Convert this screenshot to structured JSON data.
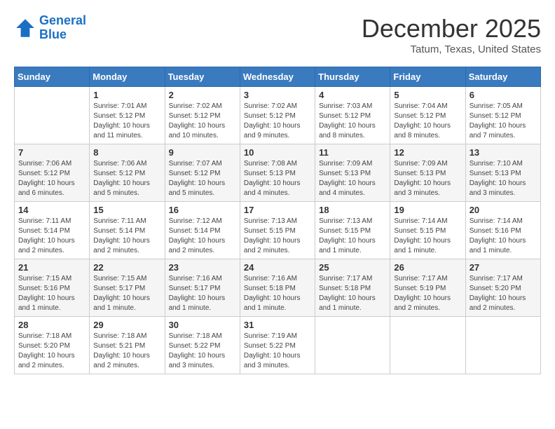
{
  "header": {
    "logo_line1": "General",
    "logo_line2": "Blue",
    "month": "December 2025",
    "location": "Tatum, Texas, United States"
  },
  "weekdays": [
    "Sunday",
    "Monday",
    "Tuesday",
    "Wednesday",
    "Thursday",
    "Friday",
    "Saturday"
  ],
  "weeks": [
    [
      {
        "day": "",
        "info": ""
      },
      {
        "day": "1",
        "info": "Sunrise: 7:01 AM\nSunset: 5:12 PM\nDaylight: 10 hours\nand 11 minutes."
      },
      {
        "day": "2",
        "info": "Sunrise: 7:02 AM\nSunset: 5:12 PM\nDaylight: 10 hours\nand 10 minutes."
      },
      {
        "day": "3",
        "info": "Sunrise: 7:02 AM\nSunset: 5:12 PM\nDaylight: 10 hours\nand 9 minutes."
      },
      {
        "day": "4",
        "info": "Sunrise: 7:03 AM\nSunset: 5:12 PM\nDaylight: 10 hours\nand 8 minutes."
      },
      {
        "day": "5",
        "info": "Sunrise: 7:04 AM\nSunset: 5:12 PM\nDaylight: 10 hours\nand 8 minutes."
      },
      {
        "day": "6",
        "info": "Sunrise: 7:05 AM\nSunset: 5:12 PM\nDaylight: 10 hours\nand 7 minutes."
      }
    ],
    [
      {
        "day": "7",
        "info": "Sunrise: 7:06 AM\nSunset: 5:12 PM\nDaylight: 10 hours\nand 6 minutes."
      },
      {
        "day": "8",
        "info": "Sunrise: 7:06 AM\nSunset: 5:12 PM\nDaylight: 10 hours\nand 5 minutes."
      },
      {
        "day": "9",
        "info": "Sunrise: 7:07 AM\nSunset: 5:12 PM\nDaylight: 10 hours\nand 5 minutes."
      },
      {
        "day": "10",
        "info": "Sunrise: 7:08 AM\nSunset: 5:13 PM\nDaylight: 10 hours\nand 4 minutes."
      },
      {
        "day": "11",
        "info": "Sunrise: 7:09 AM\nSunset: 5:13 PM\nDaylight: 10 hours\nand 4 minutes."
      },
      {
        "day": "12",
        "info": "Sunrise: 7:09 AM\nSunset: 5:13 PM\nDaylight: 10 hours\nand 3 minutes."
      },
      {
        "day": "13",
        "info": "Sunrise: 7:10 AM\nSunset: 5:13 PM\nDaylight: 10 hours\nand 3 minutes."
      }
    ],
    [
      {
        "day": "14",
        "info": "Sunrise: 7:11 AM\nSunset: 5:14 PM\nDaylight: 10 hours\nand 2 minutes."
      },
      {
        "day": "15",
        "info": "Sunrise: 7:11 AM\nSunset: 5:14 PM\nDaylight: 10 hours\nand 2 minutes."
      },
      {
        "day": "16",
        "info": "Sunrise: 7:12 AM\nSunset: 5:14 PM\nDaylight: 10 hours\nand 2 minutes."
      },
      {
        "day": "17",
        "info": "Sunrise: 7:13 AM\nSunset: 5:15 PM\nDaylight: 10 hours\nand 2 minutes."
      },
      {
        "day": "18",
        "info": "Sunrise: 7:13 AM\nSunset: 5:15 PM\nDaylight: 10 hours\nand 1 minute."
      },
      {
        "day": "19",
        "info": "Sunrise: 7:14 AM\nSunset: 5:15 PM\nDaylight: 10 hours\nand 1 minute."
      },
      {
        "day": "20",
        "info": "Sunrise: 7:14 AM\nSunset: 5:16 PM\nDaylight: 10 hours\nand 1 minute."
      }
    ],
    [
      {
        "day": "21",
        "info": "Sunrise: 7:15 AM\nSunset: 5:16 PM\nDaylight: 10 hours\nand 1 minute."
      },
      {
        "day": "22",
        "info": "Sunrise: 7:15 AM\nSunset: 5:17 PM\nDaylight: 10 hours\nand 1 minute."
      },
      {
        "day": "23",
        "info": "Sunrise: 7:16 AM\nSunset: 5:17 PM\nDaylight: 10 hours\nand 1 minute."
      },
      {
        "day": "24",
        "info": "Sunrise: 7:16 AM\nSunset: 5:18 PM\nDaylight: 10 hours\nand 1 minute."
      },
      {
        "day": "25",
        "info": "Sunrise: 7:17 AM\nSunset: 5:18 PM\nDaylight: 10 hours\nand 1 minute."
      },
      {
        "day": "26",
        "info": "Sunrise: 7:17 AM\nSunset: 5:19 PM\nDaylight: 10 hours\nand 2 minutes."
      },
      {
        "day": "27",
        "info": "Sunrise: 7:17 AM\nSunset: 5:20 PM\nDaylight: 10 hours\nand 2 minutes."
      }
    ],
    [
      {
        "day": "28",
        "info": "Sunrise: 7:18 AM\nSunset: 5:20 PM\nDaylight: 10 hours\nand 2 minutes."
      },
      {
        "day": "29",
        "info": "Sunrise: 7:18 AM\nSunset: 5:21 PM\nDaylight: 10 hours\nand 2 minutes."
      },
      {
        "day": "30",
        "info": "Sunrise: 7:18 AM\nSunset: 5:22 PM\nDaylight: 10 hours\nand 3 minutes."
      },
      {
        "day": "31",
        "info": "Sunrise: 7:19 AM\nSunset: 5:22 PM\nDaylight: 10 hours\nand 3 minutes."
      },
      {
        "day": "",
        "info": ""
      },
      {
        "day": "",
        "info": ""
      },
      {
        "day": "",
        "info": ""
      }
    ]
  ]
}
